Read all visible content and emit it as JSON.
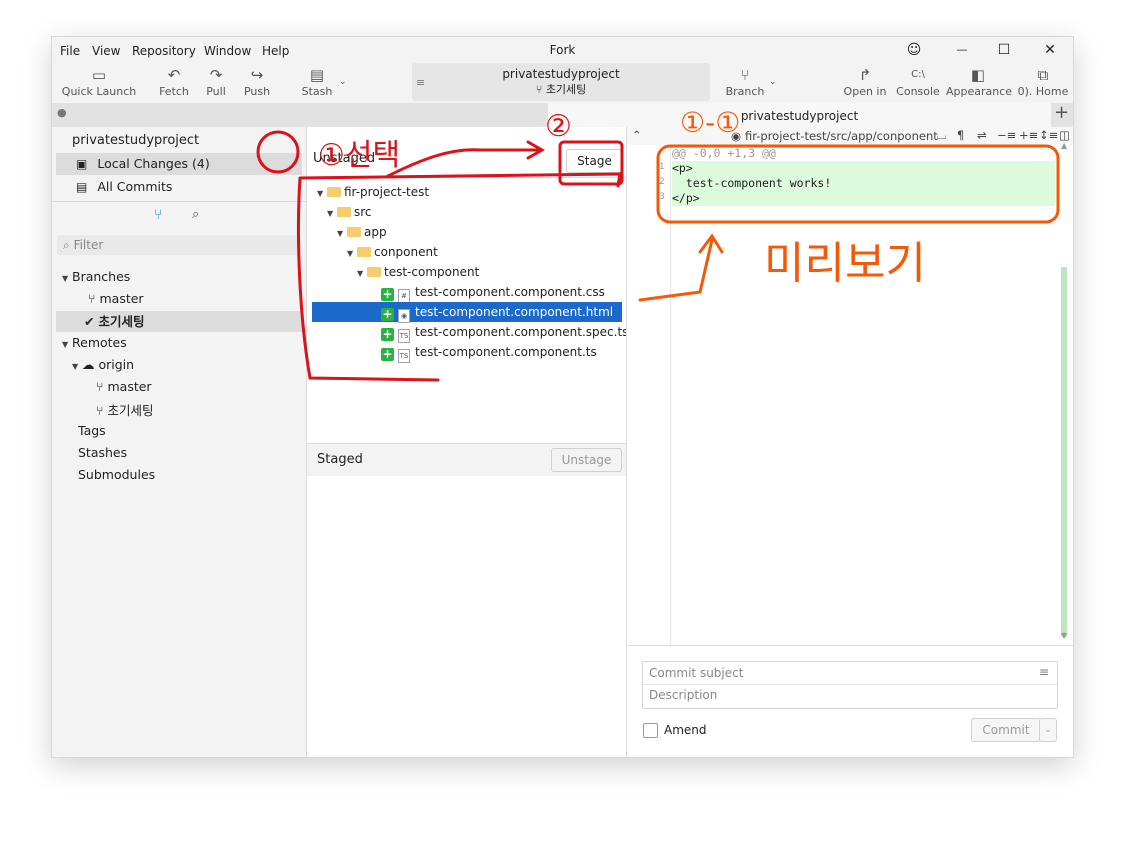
{
  "app": {
    "title": "Fork"
  },
  "menu": [
    "File",
    "View",
    "Repository",
    "Window",
    "Help"
  ],
  "window_controls": {
    "smile": "☺",
    "minimize": "—",
    "maximize": "☐",
    "close": "✕"
  },
  "toolbar": {
    "quick_launch": "Quick Launch",
    "fetch": "Fetch",
    "pull": "Pull",
    "push": "Push",
    "stash": "Stash",
    "branch": "Branch",
    "open_in": "Open in",
    "console": "Console",
    "appearance": "Appearance",
    "home": "0). Home",
    "repo_name": "privatestudyproject",
    "current_branch": "초기세팅"
  },
  "tab": {
    "title": "privatestudyproject"
  },
  "sidebar": {
    "repo": "privatestudyproject",
    "local_changes": "Local Changes (4)",
    "all_commits": "All Commits",
    "filter_placeholder": "Filter",
    "branches_label": "Branches",
    "branches": [
      "master",
      "초기세팅"
    ],
    "remotes_label": "Remotes",
    "origin": "origin",
    "remote_branches": [
      "master",
      "초기세팅"
    ],
    "tags": "Tags",
    "stashes": "Stashes",
    "submodules": "Submodules"
  },
  "unstaged": {
    "label": "Unstaged",
    "stage_button": "Stage",
    "tree": {
      "root": "fir-project-test",
      "src": "src",
      "app": "app",
      "conponent": "conponent",
      "test_component": "test-component"
    },
    "files": [
      "test-component.component.css",
      "test-component.component.html",
      "test-component.component.spec.ts",
      "test-component.component.ts"
    ]
  },
  "staged": {
    "label": "Staged",
    "unstage_button": "Unstage"
  },
  "diff": {
    "path": "fir-project-test/src/app/conponent",
    "hunk": "@@ -0,0 +1,3 @@",
    "lines": [
      {
        "num": "1",
        "text": "<p>"
      },
      {
        "num": "2",
        "text": "  test-component works!"
      },
      {
        "num": "3",
        "text": "</p>"
      }
    ]
  },
  "commit": {
    "subject_placeholder": "Commit subject",
    "description_placeholder": "Description",
    "amend": "Amend",
    "commit_button": "Commit"
  },
  "annotations": {
    "select": "①선택",
    "step2": "②",
    "step1_1": "①-①",
    "preview": "미리보기"
  },
  "colors": {
    "accent": "#1b6acb",
    "added": "#27b43e",
    "diff_bg": "#dcfadc",
    "annotation_red": "#d9131a",
    "annotation_orange": "#f25a0a"
  }
}
